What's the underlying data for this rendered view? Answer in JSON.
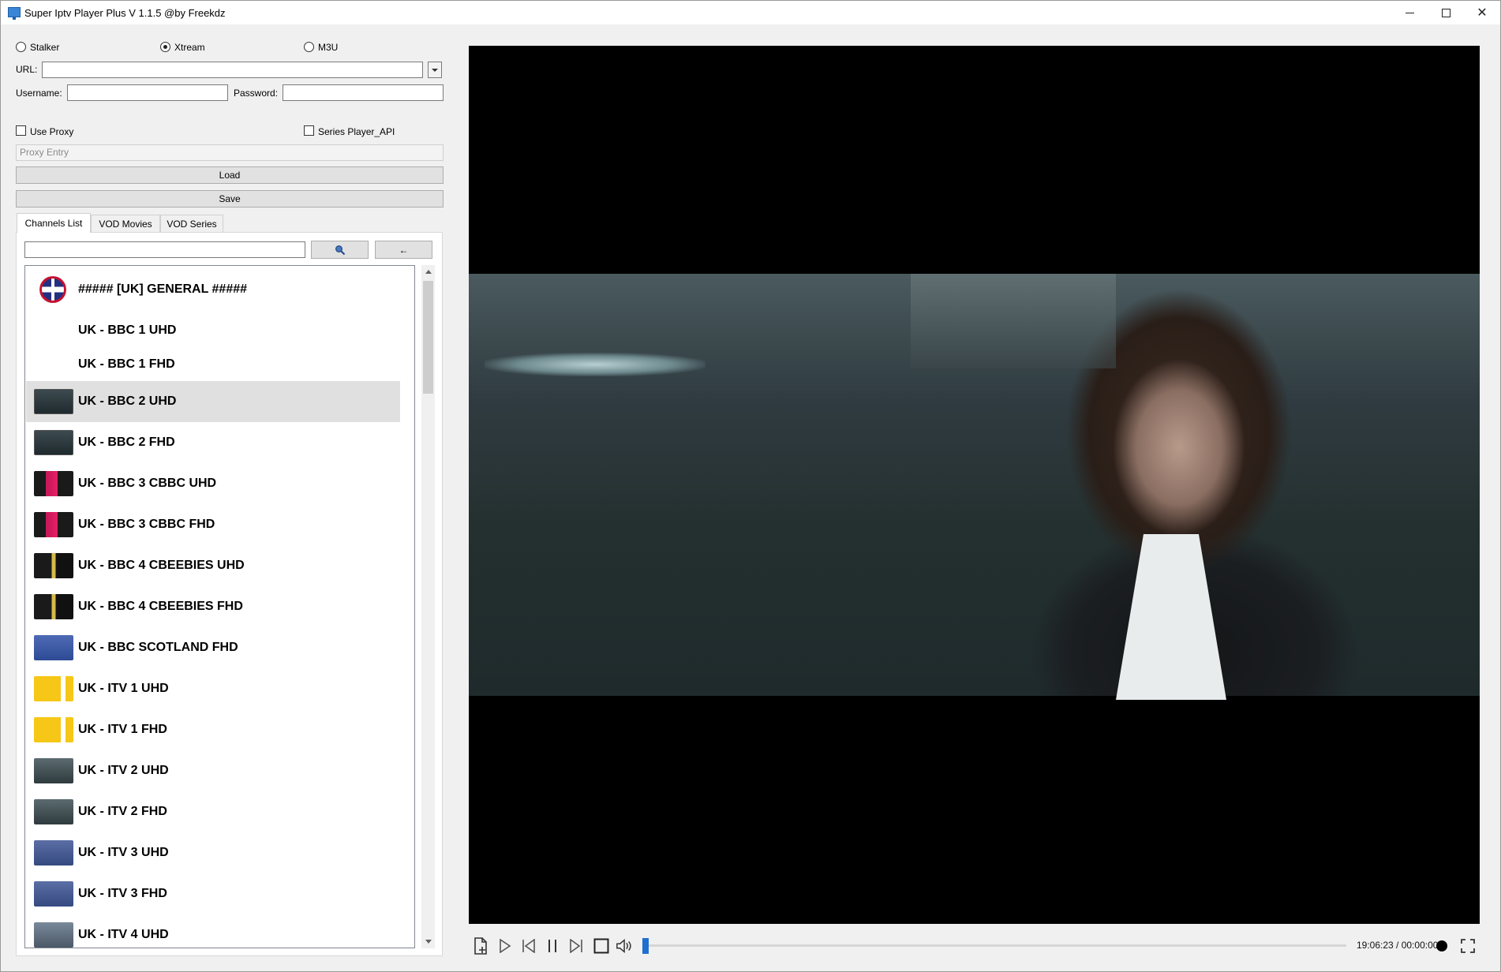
{
  "window": {
    "title": "Super Iptv Player Plus V 1.1.5 @by Freekdz",
    "minimize": "—",
    "maximize": "☐",
    "close": "✕"
  },
  "source": {
    "options": [
      {
        "label": "Stalker",
        "checked": false
      },
      {
        "label": "Xtream",
        "checked": true
      },
      {
        "label": "M3U",
        "checked": false
      }
    ]
  },
  "form": {
    "url_label": "URL:",
    "url_value": "",
    "username_label": "Username:",
    "username_value": "",
    "password_label": "Password:",
    "password_value": "",
    "use_proxy_label": "Use Proxy",
    "series_api_label": "Series Player_API",
    "proxy_placeholder": "Proxy Entry",
    "load_label": "Load",
    "save_label": "Save"
  },
  "tabs": [
    {
      "label": "Channels List",
      "active": true
    },
    {
      "label": "VOD Movies",
      "active": false
    },
    {
      "label": "VOD Series",
      "active": false
    }
  ],
  "search": {
    "value": "",
    "search_icon": "magnifier-icon",
    "back_label": "←"
  },
  "channels": [
    {
      "name": "##### [UK] GENERAL #####",
      "logo": "uk-flag",
      "selected": false
    },
    {
      "name": "UK - BBC 1 UHD",
      "logo": "none",
      "selected": false
    },
    {
      "name": "UK - BBC 1 FHD",
      "logo": "none",
      "selected": false
    },
    {
      "name": "UK - BBC 2 UHD",
      "logo": "bbc-two",
      "selected": true
    },
    {
      "name": "UK - BBC 2 FHD",
      "logo": "bbc-two",
      "selected": false
    },
    {
      "name": "UK - BBC 3 CBBC UHD",
      "logo": "bbc-three",
      "selected": false
    },
    {
      "name": "UK - BBC 3 CBBC FHD",
      "logo": "bbc-three",
      "selected": false
    },
    {
      "name": "UK - BBC 4 CBEEBIES UHD",
      "logo": "bbc-four",
      "selected": false
    },
    {
      "name": "UK - BBC 4 CBEEBIES FHD",
      "logo": "bbc-four",
      "selected": false
    },
    {
      "name": "UK - BBC SCOTLAND FHD",
      "logo": "bbc-scotland",
      "selected": false
    },
    {
      "name": "UK - ITV 1 UHD",
      "logo": "itv1",
      "selected": false
    },
    {
      "name": "UK - ITV 1 FHD",
      "logo": "itv1",
      "selected": false
    },
    {
      "name": "UK - ITV 2 UHD",
      "logo": "itv2",
      "selected": false
    },
    {
      "name": "UK - ITV 2 FHD",
      "logo": "itv2",
      "selected": false
    },
    {
      "name": "UK - ITV 3 UHD",
      "logo": "itv3",
      "selected": false
    },
    {
      "name": "UK - ITV 3 FHD",
      "logo": "itv3",
      "selected": false
    },
    {
      "name": "UK - ITV 4 UHD",
      "logo": "itv4",
      "selected": false
    }
  ],
  "player": {
    "time": "19:06:23 / 00:00:00",
    "progress": 0.0,
    "icons": [
      "open-file-icon",
      "play-icon",
      "previous-icon",
      "pause-icon",
      "next-icon",
      "stop-icon",
      "volume-icon",
      "record-icon",
      "fullscreen-icon"
    ]
  },
  "colors": {
    "selection": "#e0e0e0",
    "accent": "#1e6fd0",
    "video_bg": "#000000"
  }
}
